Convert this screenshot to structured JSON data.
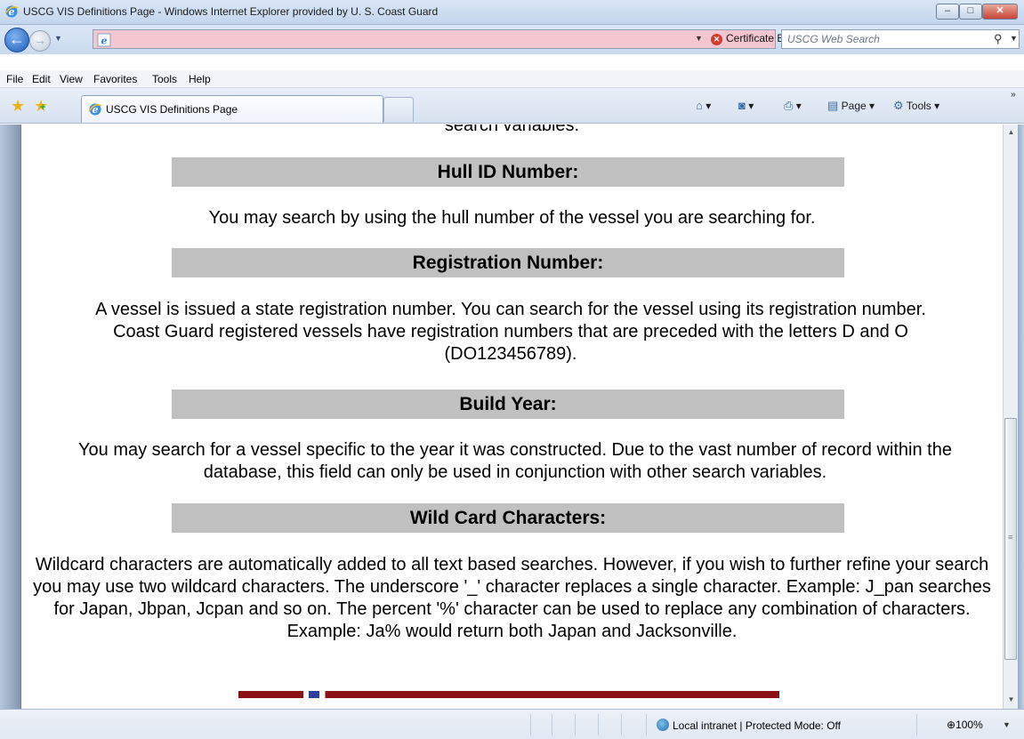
{
  "window": {
    "title": "USCG VIS Definitions Page - Windows Internet Explorer provided by U. S. Coast Guard",
    "min_label": "–",
    "max_label": "□",
    "close_label": "✕"
  },
  "address_bar": {
    "url": "",
    "certificate_error": "Certificate Error",
    "search_placeholder": "USCG Web Search"
  },
  "menu": {
    "items": [
      "File",
      "Edit",
      "View",
      "Favorites",
      "Tools",
      "Help"
    ]
  },
  "tabs": {
    "active_label": "USCG VIS Definitions Page"
  },
  "command_bar": {
    "page_label": "Page",
    "tools_label": "Tools"
  },
  "content": {
    "cut_off_text": "search variables.",
    "sections": [
      {
        "heading": "Hull ID Number:",
        "body": "You may search by using the hull number of the vessel you are searching for."
      },
      {
        "heading": "Registration Number:",
        "body": "A vessel is issued a state registration number.  You can search for the vessel using its registration number.  Coast Guard registered vessels have registration numbers that are preceded with the letters D and O (DO123456789)."
      },
      {
        "heading": "Build Year:",
        "body": "You may search for a vessel specific to the year it was constructed.  Due to the vast number of record within the database, this field can only be used in conjunction with other search variables."
      },
      {
        "heading": "Wild Card Characters:",
        "body": "Wildcard characters are automatically added to all text based searches. However, if you wish to further refine your search you may use two wildcard characters. The underscore '_' character replaces a single character. Example: J_pan searches for Japan, Jbpan, Jcpan and so on. The percent '%' character can be used to replace any combination of characters. Example: Ja% would return both Japan and Jacksonville."
      }
    ]
  },
  "status_bar": {
    "zone": "Local intranet | Protected Mode: Off",
    "zoom": "100%"
  },
  "colors": {
    "section_bar": "#c0c0c0",
    "address_error_bg": "#f3c6d0",
    "flag_red": "#8b1115",
    "flag_blue": "#2a3f9d"
  }
}
